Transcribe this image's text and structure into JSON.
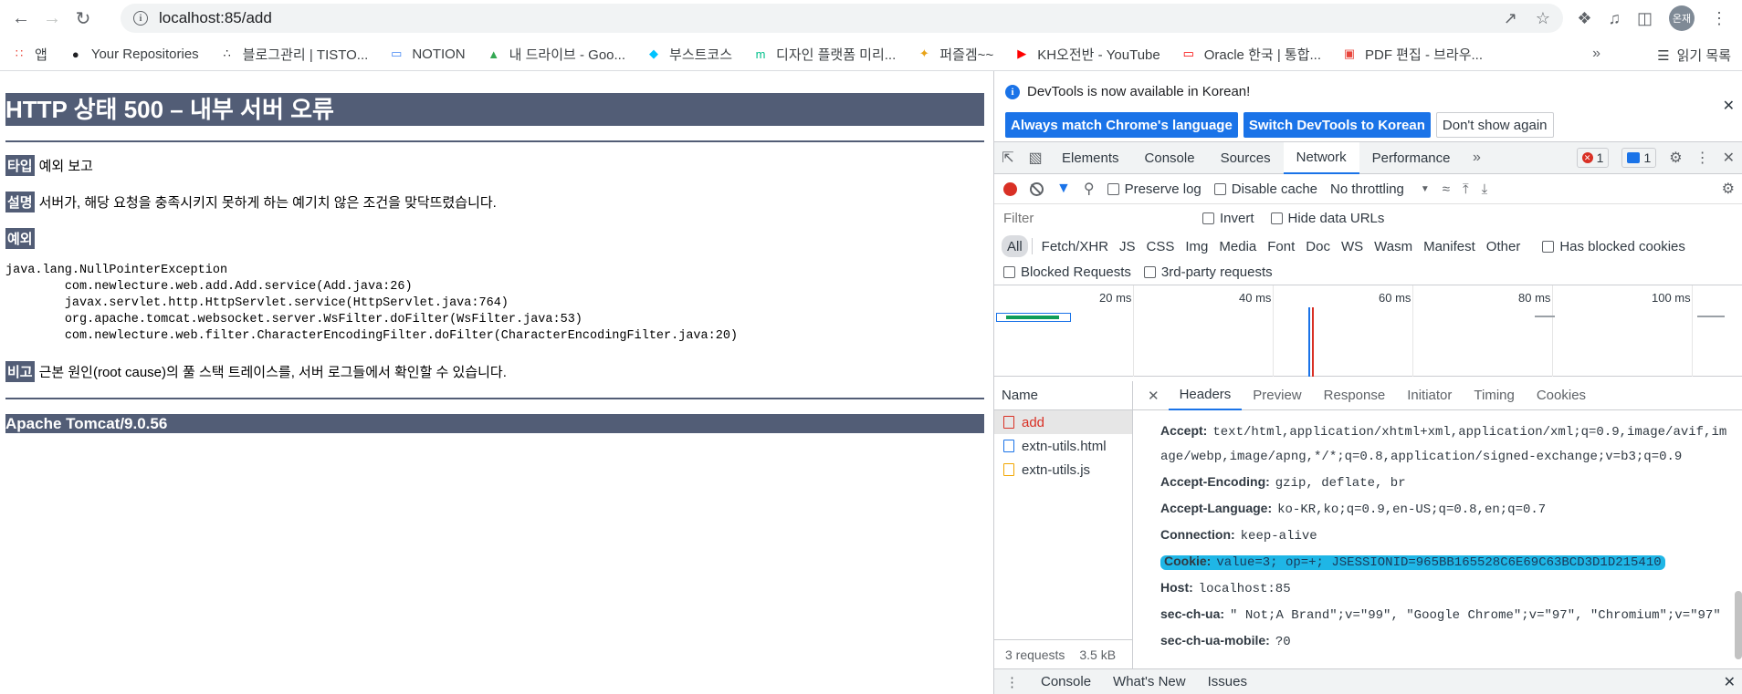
{
  "browser": {
    "url": "localhost:85/add",
    "profile_label": "온재",
    "bookmarks": [
      {
        "label": "앱",
        "icon": "apps-grid-icon",
        "color": "#ea4335"
      },
      {
        "label": "Your Repositories",
        "icon": "github-icon",
        "color": "#202124"
      },
      {
        "label": "블로그관리 | TISTO...",
        "icon": "tistory-icon",
        "color": "#202124"
      },
      {
        "label": "NOTION",
        "icon": "laptop-icon",
        "color": "#4285f4"
      },
      {
        "label": "내 드라이브 - Goo...",
        "icon": "google-drive-icon",
        "color": "#34a853"
      },
      {
        "label": "부스트코스",
        "icon": "boostcourse-icon",
        "color": "#00c3ff"
      },
      {
        "label": "디자인 플랫폼 미리...",
        "icon": "miri-icon",
        "color": "#00c08b"
      },
      {
        "label": "퍼즐겜~~",
        "icon": "puzzle-icon",
        "color": "#e8a317"
      },
      {
        "label": "KH오전반 - YouTube",
        "icon": "youtube-icon",
        "color": "#ff0000"
      },
      {
        "label": "Oracle 한국 | 통합...",
        "icon": "oracle-icon",
        "color": "#f80000"
      },
      {
        "label": "PDF 편집 - 브라우...",
        "icon": "pdf-icon",
        "color": "#e8453c"
      }
    ],
    "reading_list": "읽기 목록"
  },
  "page": {
    "title": "HTTP 상태 500 – 내부 서버 오류",
    "type_tag": "타입",
    "type_text": "예외 보고",
    "desc_tag": "설명",
    "desc_text": "서버가, 해당 요청을 충족시키지 못하게 하는 예기치 않은 조건을 맞닥뜨렸습니다.",
    "exception_tag": "예외",
    "stack_trace": "java.lang.NullPointerException\n\tcom.newlecture.web.add.Add.service(Add.java:26)\n\tjavax.servlet.http.HttpServlet.service(HttpServlet.java:764)\n\torg.apache.tomcat.websocket.server.WsFilter.doFilter(WsFilter.java:53)\n\tcom.newlecture.web.filter.CharacterEncodingFilter.doFilter(CharacterEncodingFilter.java:20)",
    "note_tag": "비고",
    "note_text": "근본 원인(root cause)의 풀 스택 트레이스를, 서버 로그들에서 확인할 수 있습니다.",
    "footer": "Apache Tomcat/9.0.56"
  },
  "devtools": {
    "notice_text": "DevTools is now available in Korean!",
    "notice_buttons": [
      "Always match Chrome's language",
      "Switch DevTools to Korean",
      "Don't show again"
    ],
    "tabs": [
      "Elements",
      "Console",
      "Sources",
      "Network",
      "Performance"
    ],
    "active_tab": "Network",
    "error_count": "1",
    "message_count": "1",
    "toolbar": {
      "preserve_log": "Preserve log",
      "disable_cache": "Disable cache",
      "throttling": "No throttling"
    },
    "filter_placeholder": "Filter",
    "invert": "Invert",
    "hide_data_urls": "Hide data URLs",
    "types": [
      "All",
      "Fetch/XHR",
      "JS",
      "CSS",
      "Img",
      "Media",
      "Font",
      "Doc",
      "WS",
      "Wasm",
      "Manifest",
      "Other"
    ],
    "has_blocked_cookies": "Has blocked cookies",
    "blocked_requests": "Blocked Requests",
    "third_party": "3rd-party requests",
    "timeline_ticks": [
      "20 ms",
      "40 ms",
      "60 ms",
      "80 ms",
      "100 ms"
    ],
    "name_header": "Name",
    "requests": [
      {
        "name": "add",
        "kind": "error"
      },
      {
        "name": "extn-utils.html",
        "kind": "doc"
      },
      {
        "name": "extn-utils.js",
        "kind": "script"
      }
    ],
    "requests_summary": "3 requests",
    "transfer_size": "3.5 kB",
    "detail_tabs": [
      "Headers",
      "Preview",
      "Response",
      "Initiator",
      "Timing",
      "Cookies"
    ],
    "request_headers": [
      {
        "key": "Accept:",
        "value": "text/html,application/xhtml+xml,application/xml;q=0.9,image/avif,image/webp,image/apng,*/*;q=0.8,application/signed-exchange;v=b3;q=0.9",
        "wrap": true
      },
      {
        "key": "Accept-Encoding:",
        "value": "gzip, deflate, br"
      },
      {
        "key": "Accept-Language:",
        "value": "ko-KR,ko;q=0.9,en-US;q=0.8,en;q=0.7"
      },
      {
        "key": "Connection:",
        "value": "keep-alive"
      },
      {
        "key": "Cookie:",
        "value": "value=3; op=+; JSESSIONID=965BB165528C6E69C63BCD3D1D215410",
        "highlight": true
      },
      {
        "key": "Host:",
        "value": "localhost:85"
      },
      {
        "key": "sec-ch-ua:",
        "value": "\" Not;A Brand\";v=\"99\", \"Google Chrome\";v=\"97\", \"Chromium\";v=\"97\"",
        "wrap": true
      },
      {
        "key": "sec-ch-ua-mobile:",
        "value": "?0"
      }
    ],
    "drawer_tabs": [
      "Console",
      "What's New",
      "Issues"
    ]
  }
}
